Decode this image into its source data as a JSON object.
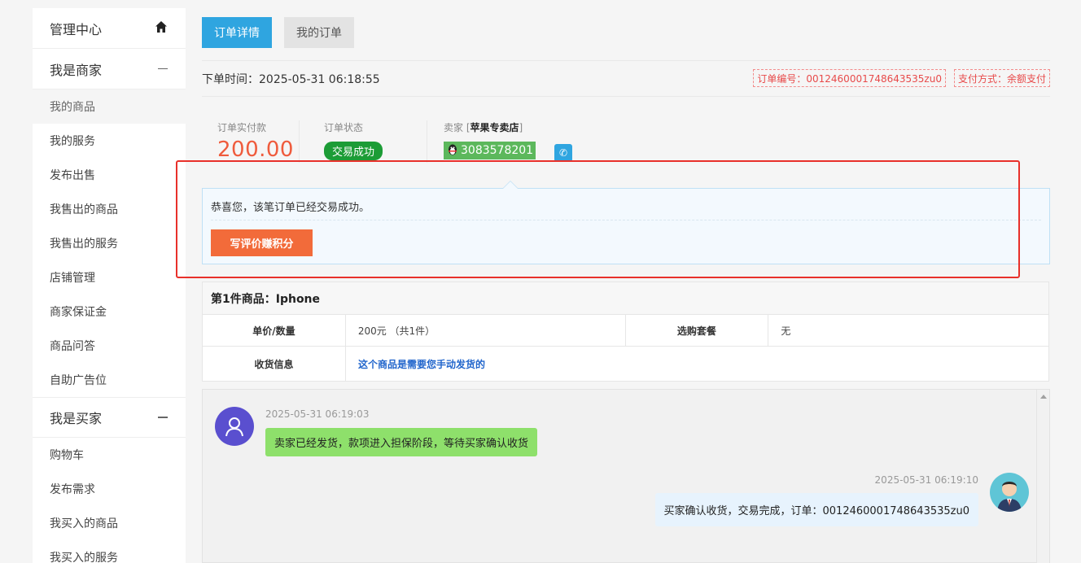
{
  "sidebar": {
    "admin_center": "管理中心",
    "merchant_section": "我是商家",
    "merchant_items": [
      "我的商品",
      "我的服务",
      "发布出售",
      "我售出的商品",
      "我售出的服务",
      "店铺管理",
      "商家保证金",
      "商品问答",
      "自助广告位"
    ],
    "buyer_section": "我是买家",
    "buyer_items": [
      "购物车",
      "发布需求",
      "我买入的商品",
      "我买入的服务"
    ],
    "icons": {
      "home": "home-icon",
      "collapse": "minus-icon"
    }
  },
  "tabs": {
    "order_detail": "订单详情",
    "my_orders": "我的订单"
  },
  "order": {
    "time_label": "下单时间：",
    "time": "2025-05-31 06:18:55",
    "order_no_tag": "订单编号：0012460001748643535zu0",
    "pay_method_tag": "支付方式：余额支付"
  },
  "summary": {
    "paid_label": "订单实付款",
    "paid_amount": "200.00",
    "status_label": "订单状态",
    "status": "交易成功",
    "seller_label": "卖家",
    "seller_open": "[",
    "seller_name": "苹果专卖店",
    "seller_close": "]",
    "qq_number": "3083578201"
  },
  "notice": {
    "text": "恭喜您，该笔订单已经交易成功。",
    "review_button": "写评价赚积分"
  },
  "product": {
    "title": "第1件商品：Iphone",
    "unit_qty_label": "单价/数量",
    "unit_qty_value": "200元 （共1件）",
    "package_label": "选购套餐",
    "package_value": "无",
    "shipping_label": "收货信息",
    "shipping_value": "这个商品是需要您手动发货的"
  },
  "chat": {
    "msg1_time": "2025-05-31 06:19:03",
    "msg1_text": "卖家已经发货，款项进入担保阶段，等待买家确认收货",
    "msg2_time": "2025-05-31 06:19:10",
    "msg2_text": "买家确认收货，交易完成，订单：0012460001748643535zu0"
  },
  "colors": {
    "accent_blue": "#2fa5e0",
    "status_green": "#1c9c36",
    "amount_red": "#ef5b3c",
    "review_orange": "#f26b3a",
    "highlight_red": "#e8302a"
  }
}
